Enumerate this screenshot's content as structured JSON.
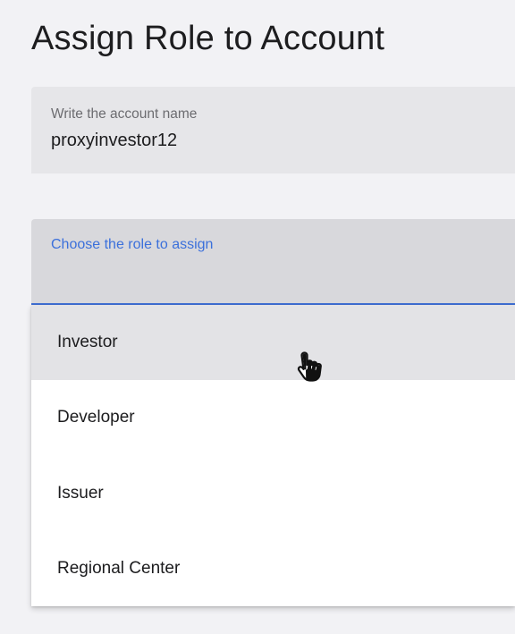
{
  "page": {
    "title": "Assign Role to Account"
  },
  "account_field": {
    "label": "Write the account name",
    "value": "proxyinvestor12"
  },
  "role_field": {
    "label": "Choose the role to assign",
    "options": [
      "Investor",
      "Developer",
      "Issuer",
      "Regional Center"
    ],
    "hovered_option": "Investor"
  },
  "colors": {
    "accent": "#3b70db",
    "background": "#f2f2f5",
    "field_background": "#e6e6e9",
    "hover_background": "#e3e3e6"
  },
  "icons": {
    "cursor": "hand-pointer-icon"
  }
}
